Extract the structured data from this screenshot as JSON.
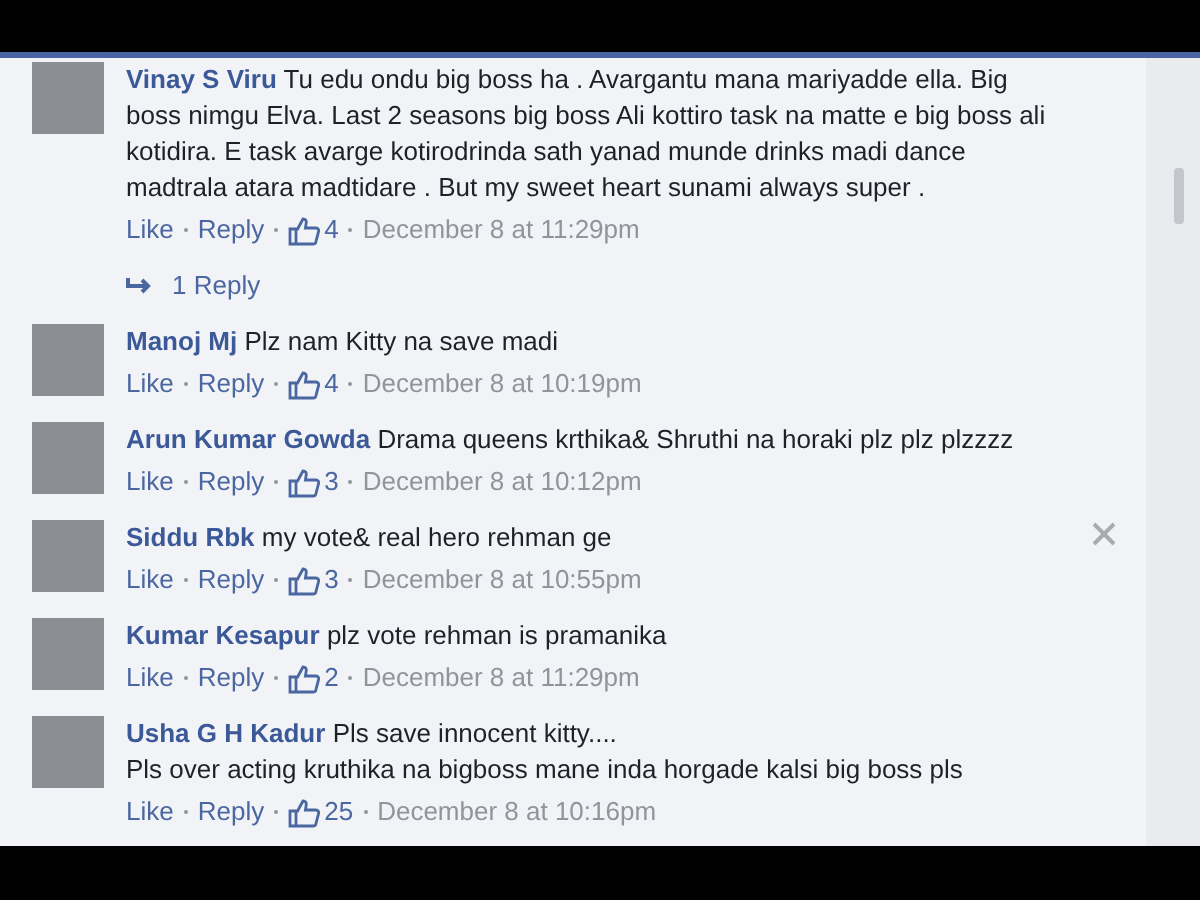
{
  "comments": [
    {
      "author": "Vinay S Viru",
      "text": "Tu edu ondu big boss ha . Avargantu mana mariyadde ella. Big boss nimgu Elva. Last 2 seasons big boss Ali kottiro task na matte e big boss ali kotidira. E task avarge kotirodrinda sath yanad munde drinks madi dance madtrala atara madtidare . But my sweet heart sunami always super .",
      "like": "Like",
      "reply": "Reply",
      "likes": "4",
      "time": "December 8 at 11:29pm",
      "replies": "1 Reply",
      "close_visible": false
    },
    {
      "author": "Manoj Mj",
      "text": "Plz nam Kitty na save madi",
      "like": "Like",
      "reply": "Reply",
      "likes": "4",
      "time": "December 8 at 10:19pm",
      "close_visible": false
    },
    {
      "author": "Arun Kumar Gowda",
      "text": "Drama queens krthika& Shruthi na horaki plz plz plzzzz",
      "like": "Like",
      "reply": "Reply",
      "likes": "3",
      "time": "December 8 at 10:12pm",
      "close_visible": false
    },
    {
      "author": "Siddu Rbk",
      "text": "my vote& real hero rehman ge",
      "like": "Like",
      "reply": "Reply",
      "likes": "3",
      "time": "December 8 at 10:55pm",
      "close_visible": true
    },
    {
      "author": "Kumar Kesapur",
      "text": "plz vote rehman is pramanika",
      "like": "Like",
      "reply": "Reply",
      "likes": "2",
      "time": "December 8 at 11:29pm",
      "close_visible": false
    },
    {
      "author": "Usha G H Kadur",
      "text": "Pls save innocent kitty....\nPls over acting kruthika na bigboss mane inda horgade kalsi big boss pls",
      "like": "Like",
      "reply": "Reply",
      "likes": "25",
      "time": "December 8 at 10:16pm",
      "close_visible": false
    }
  ]
}
